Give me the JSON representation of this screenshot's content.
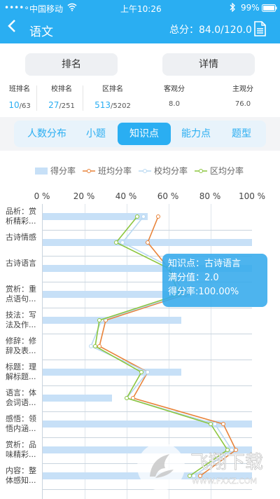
{
  "status_bar": {
    "signal": "••••∘",
    "carrier": "中国移动",
    "time": "上午10:26",
    "battery": "99%"
  },
  "header": {
    "title": "语文",
    "score": "总分：84.0/120.0"
  },
  "buttons": {
    "ranking": "排名",
    "details": "详情"
  },
  "stats": [
    {
      "label": "班排名",
      "value": "10",
      "total": "/63"
    },
    {
      "label": "校排名",
      "value": "27",
      "total": "/251"
    },
    {
      "label": "区排名",
      "value": "513",
      "total": "/5202"
    },
    {
      "label": "客观分",
      "value": "8.0",
      "total": ""
    },
    {
      "label": "主观分",
      "value": "76.0",
      "total": ""
    }
  ],
  "tabs": [
    {
      "label": "人数分布",
      "active": false
    },
    {
      "label": "小题",
      "active": false
    },
    {
      "label": "知识点",
      "active": true
    },
    {
      "label": "能力点",
      "active": false
    },
    {
      "label": "题型",
      "active": false
    }
  ],
  "legend": [
    "得分率",
    "班均分率",
    "校均分率",
    "区均分率"
  ],
  "colors": {
    "accent": "#2aaef2",
    "score": "#c7e0f7",
    "class": "#e8833a",
    "school": "#b9d9f2",
    "district": "#8cc63f"
  },
  "chart_data": {
    "type": "bar",
    "orientation": "horizontal",
    "xlim": [
      0,
      100
    ],
    "xticks": [
      "0 %",
      "20 %",
      "40 %",
      "60 %",
      "80 %",
      "100 %"
    ],
    "categories": [
      "品析：赏析精彩...",
      "古诗情感",
      "古诗语言",
      "赏析：重点语句...",
      "技法：写法及作...",
      "修辞：修辞及表...",
      "标题：理解标题...",
      "语言：体会词语...",
      "感悟：领悟内涵...",
      "赏析：品味精彩...",
      "内容：整体感知..."
    ],
    "series": [
      {
        "name": "得分率",
        "type": "bar",
        "values": [
          50,
          100,
          100,
          70,
          66,
          0,
          66,
          33,
          100,
          100,
          100
        ]
      },
      {
        "name": "班均分率",
        "type": "line",
        "values": [
          55,
          50,
          60,
          68,
          30,
          27,
          50,
          43,
          86,
          92,
          75
        ]
      },
      {
        "name": "校均分率",
        "type": "line",
        "values": [
          48,
          38,
          62,
          67,
          28,
          23,
          50,
          40,
          82,
          90,
          72
        ]
      },
      {
        "name": "区均分率",
        "type": "line",
        "values": [
          45,
          35,
          60,
          65,
          27,
          25,
          47,
          40,
          80,
          88,
          70
        ]
      }
    ]
  },
  "tooltip": {
    "line1": "知识点：古诗语言",
    "line2": "满分值：2.0",
    "line3": "得分率:100.00%"
  },
  "watermark": {
    "brand": "飞翔下载",
    "site": "WWW.FXXZ.COM"
  }
}
